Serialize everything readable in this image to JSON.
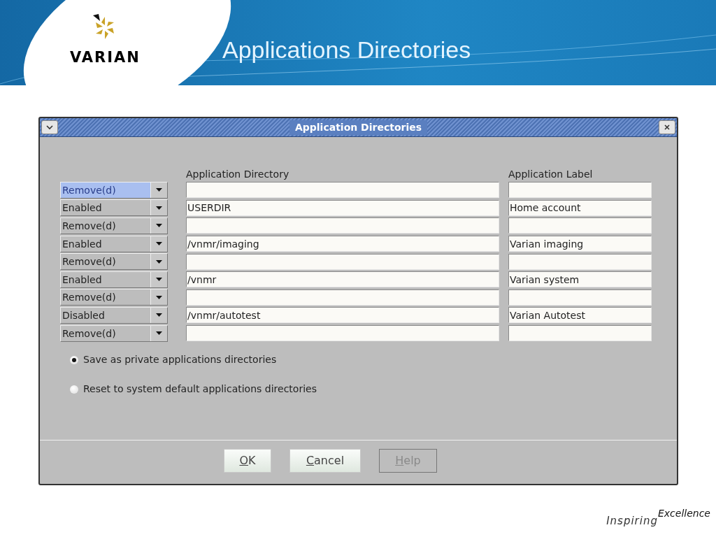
{
  "slide_title": "Applications Directories",
  "logo_text": "VARIAN",
  "dialog": {
    "title": "Application Directories",
    "column_headers": [
      "Application Directory",
      "Application Label"
    ],
    "rows": [
      {
        "status": "Remove(d)",
        "highlighted": true,
        "directory": "",
        "label": ""
      },
      {
        "status": "Enabled",
        "highlighted": false,
        "directory": "USERDIR",
        "label": "Home account"
      },
      {
        "status": "Remove(d)",
        "highlighted": false,
        "directory": "",
        "label": ""
      },
      {
        "status": "Enabled",
        "highlighted": false,
        "directory": "/vnmr/imaging",
        "label": "Varian imaging"
      },
      {
        "status": "Remove(d)",
        "highlighted": false,
        "directory": "",
        "label": ""
      },
      {
        "status": "Enabled",
        "highlighted": false,
        "directory": "/vnmr",
        "label": "Varian system"
      },
      {
        "status": "Remove(d)",
        "highlighted": false,
        "directory": "",
        "label": ""
      },
      {
        "status": "Disabled",
        "highlighted": false,
        "directory": "/vnmr/autotest",
        "label": "Varian Autotest"
      },
      {
        "status": "Remove(d)",
        "highlighted": false,
        "directory": "",
        "label": ""
      }
    ],
    "options": [
      {
        "label": "Save as private applications directories",
        "selected": true
      },
      {
        "label": "Reset to system default applications directories",
        "selected": false
      }
    ],
    "buttons": [
      {
        "label": "OK",
        "disabled": false
      },
      {
        "label": "Cancel",
        "disabled": false
      },
      {
        "label": "Help",
        "disabled": true
      }
    ]
  },
  "tagline": [
    "Inspiring",
    "Excellence"
  ]
}
